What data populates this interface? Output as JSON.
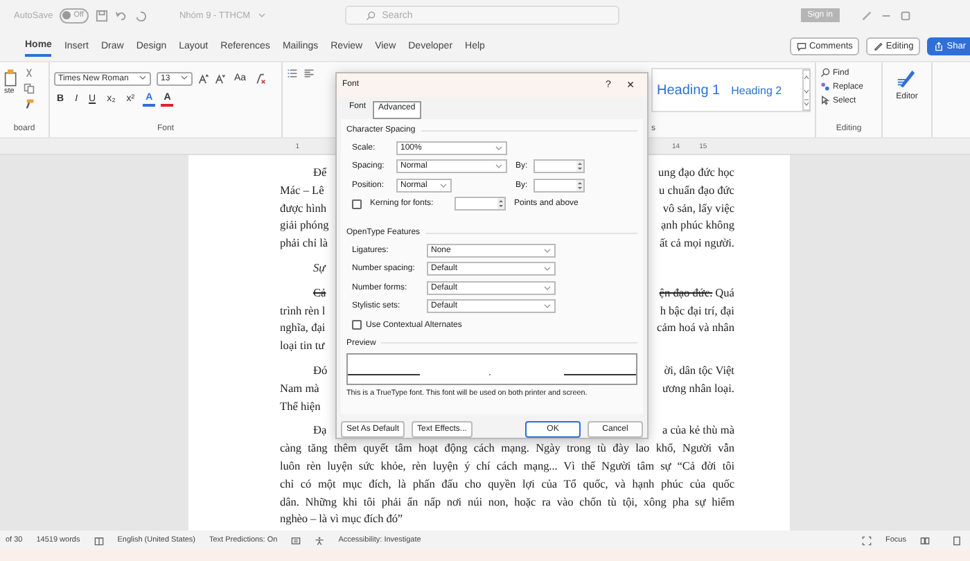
{
  "title_bar": {
    "autosave_label": "AutoSave",
    "autosave_state": "Off",
    "autosave_on": false,
    "document_title": "Nhóm 9 - TTHCM",
    "search_placeholder": "Search",
    "sign_in": "Sign in"
  },
  "ribbon_tabs": [
    {
      "label": "Home",
      "selected": true
    },
    {
      "label": "Insert",
      "selected": false
    },
    {
      "label": "Draw",
      "selected": false
    },
    {
      "label": "Design",
      "selected": false
    },
    {
      "label": "Layout",
      "selected": false
    },
    {
      "label": "References",
      "selected": false
    },
    {
      "label": "Mailings",
      "selected": false
    },
    {
      "label": "Review",
      "selected": false
    },
    {
      "label": "View",
      "selected": false
    },
    {
      "label": "Developer",
      "selected": false
    },
    {
      "label": "Help",
      "selected": false
    }
  ],
  "ribbon_actions": [
    {
      "kind": "comments",
      "label": "Comments"
    },
    {
      "kind": "editing",
      "label": "Editing"
    },
    {
      "kind": "share",
      "label": "Shar"
    }
  ],
  "ribbon": {
    "clipboard": {
      "paste_label": "ste",
      "group_label": "board"
    },
    "font": {
      "font_name": "Times New Roman",
      "font_size": "13",
      "case_button": "Aa",
      "format_buttons": [
        "B",
        "I",
        "U",
        "x₂",
        "x²"
      ],
      "color_buttons": [
        {
          "label": "A",
          "color": "#2f6fd8"
        },
        {
          "label": "A",
          "color": "#e0202a"
        }
      ],
      "group_label": "Font"
    },
    "styles": {
      "items": [
        "Heading 1",
        "Heading 2"
      ],
      "group_label": "s"
    },
    "editing": {
      "items": [
        {
          "kind": "find",
          "label": "Find"
        },
        {
          "kind": "replace",
          "label": "Replace"
        },
        {
          "kind": "select",
          "label": "Select"
        }
      ],
      "group_label": "Editing"
    },
    "editor_label": "Editor"
  },
  "ruler": {
    "left_labels": [
      "1"
    ],
    "right_labels": [
      "14",
      "15"
    ]
  },
  "document": {
    "lines": [
      {
        "kind": "first",
        "left": "Để",
        "right": "ung đạo đức học"
      },
      {
        "kind": "cont",
        "left": "Mác – Lê",
        "right": "u chuẩn đạo đức"
      },
      {
        "kind": "cont",
        "left": "được hình",
        "right": "vô sản, lấy việc"
      },
      {
        "kind": "cont",
        "left": "giải phóng",
        "right": "ạnh phúc không"
      },
      {
        "kind": "cont",
        "left": "phải chỉ là",
        "right": "ất cả mọi người."
      },
      {
        "kind": "first",
        "left": "Sự",
        "italic": true
      },
      {
        "kind": "first",
        "left": "Cả",
        "right": "ện đạo đức.",
        "right_tail": "Quá",
        "struck": true
      },
      {
        "kind": "cont",
        "left": "trình rèn l",
        "right": "h bậc đại trí, đại"
      },
      {
        "kind": "cont",
        "left": "nghĩa, đại",
        "right": "cảm hoá và nhân"
      },
      {
        "kind": "cont",
        "left": "loại tin tư"
      },
      {
        "kind": "first",
        "left": "Đó",
        "right": "ời, dân tộc Việt"
      },
      {
        "kind": "cont",
        "left": "Nam mà",
        "right": "ương nhân loại."
      },
      {
        "kind": "cont",
        "left": "Thể hiện"
      },
      {
        "kind": "first",
        "left": "Đạ",
        "right": "a của kẻ thù mà"
      },
      {
        "kind": "full",
        "text": "càng tăng thêm quyết tâm hoạt động cách mạng. Ngày trong tù đày lao khổ, Người vẫn"
      },
      {
        "kind": "full",
        "text": "luôn rèn luyện sức khỏe, rèn luyện ý chí cách mạng... Vì thế Người tâm sự “Cả đời tôi"
      },
      {
        "kind": "full",
        "text": "chỉ có một mục đích, là phấn đấu cho quyền lợi của Tổ quốc, và hạnh phúc của quốc"
      },
      {
        "kind": "full",
        "text": "dân. Những khi tôi phải ẩn nấp nơi núi non, hoặc ra vào chốn tù tội, xông pha sự hiểm"
      },
      {
        "kind": "end",
        "text": "nghèo – là vì mục đích đó”"
      }
    ]
  },
  "dialog": {
    "title": "Font",
    "help": "?",
    "close": "×",
    "tabs": [
      {
        "label": "Font",
        "selected": false
      },
      {
        "label": "Advanced",
        "selected": true
      }
    ],
    "character_spacing": {
      "heading": "Character Spacing",
      "scale_label": "Scale:",
      "scale": "100%",
      "spacing_label": "Spacing:",
      "spacing": "Normal",
      "spacing_by_label": "By:",
      "position_label": "Position:",
      "position": "Normal",
      "position_by_label": "By:",
      "kerning_label": "Kerning for fonts:",
      "kerning_checked": false,
      "kerning_suffix": "Points and above"
    },
    "opentype": {
      "heading": "OpenType Features",
      "rows": [
        {
          "label": "Ligatures:",
          "value": "None"
        },
        {
          "label": "Number spacing:",
          "value": "Default"
        },
        {
          "label": "Number forms:",
          "value": "Default"
        },
        {
          "label": "Stylistic sets:",
          "value": "Default"
        }
      ],
      "contextual_label": "Use Contextual Alternates",
      "contextual_checked": false
    },
    "preview": {
      "heading": "Preview",
      "caption": "This is a TrueType font. This font will be used on both printer and screen."
    },
    "buttons": [
      {
        "label": "Set As Default",
        "default": false
      },
      {
        "label": "Text Effects...",
        "default": false
      },
      {
        "label": "OK",
        "default": true
      },
      {
        "label": "Cancel",
        "default": false
      }
    ]
  },
  "status_bar": {
    "page": "of 30",
    "words": "14519 words",
    "language": "English (United States)",
    "predictions": "Text Predictions: On",
    "accessibility": "Accessibility: Investigate",
    "focus": "Focus"
  }
}
